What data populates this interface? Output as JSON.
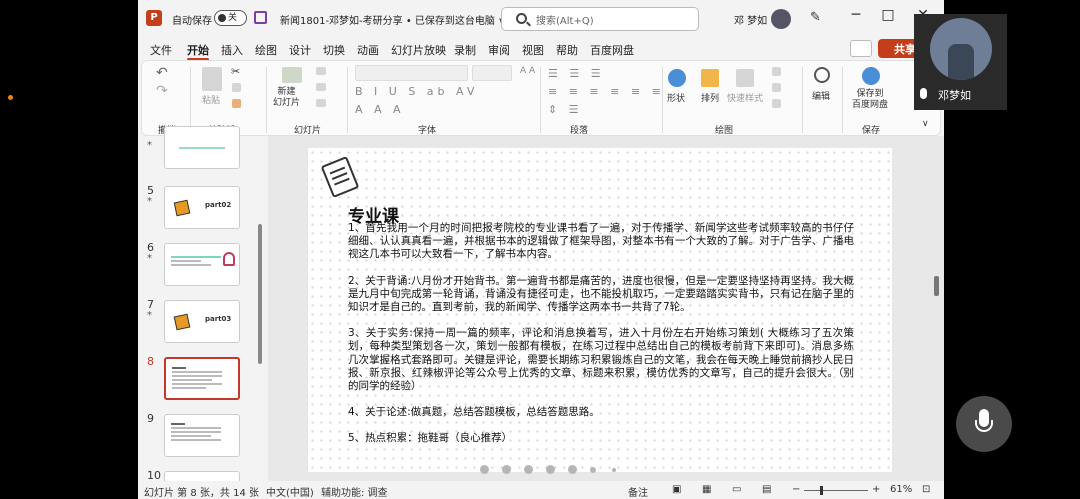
{
  "titlebar": {
    "autosave_label": "自动保存",
    "toggle_state": "关",
    "doc_title": "新闻1801-邓梦如-考研分享 • 已保存到这台电脑 ∨",
    "search_placeholder": "搜索(Alt+Q)",
    "user_name": "邓 梦如",
    "minimize": "─",
    "restore": "□",
    "close": "✕"
  },
  "tabs": [
    "文件",
    "开始",
    "插入",
    "绘图",
    "设计",
    "切换",
    "动画",
    "幻灯片放映",
    "录制",
    "审阅",
    "视图",
    "帮助",
    "百度网盘"
  ],
  "active_tab": "开始",
  "share_label": "共享",
  "ribbon": {
    "undo_group": "撤消",
    "clipboard_group": "剪贴板",
    "paste_label": "粘贴",
    "slides_group": "幻灯片",
    "new_slide_label": "新建\n幻灯片",
    "font_group": "字体",
    "paragraph_group": "段落",
    "drawing_group": "绘图",
    "shape_label": "形状",
    "arrange_label": "排列",
    "quickstyle_label": "快速样式",
    "edit_label": "编辑",
    "save_label": "保存到\n百度网盘",
    "save_group": "保存",
    "font_glyphs": "B I U S ab AV",
    "para_glyphs": "≡ ≡ ≡ ≡ ≡ ≡"
  },
  "thumbnails": [
    {
      "num": "5",
      "label": "part02\n"
    },
    {
      "num": "6",
      "label": ""
    },
    {
      "num": "7",
      "label": "part03\n"
    },
    {
      "num": "8",
      "label": ""
    },
    {
      "num": "9",
      "label": ""
    },
    {
      "num": "10",
      "label": ""
    }
  ],
  "slide": {
    "title": "专业课",
    "paragraphs": [
      "1、首先我用一个月的时间把报考院校的专业课书看了一遍，对于传播学、新闻学这些考试频率较高的书仔仔细细、认认真真看一遍，并根据书本的逻辑做了框架导图，对整本书有一个大致的了解。对于广告学、广播电视这几本书可以大致看一下，了解书本内容。",
      "2、关于背诵:八月份才开始背书。第一遍背书都是痛苦的，进度也很慢，但是一定要坚持坚持再坚持。我大概是九月中旬完成第一轮背诵，背诵没有捷径可走，也不能投机取巧，一定要踏踏实实背书，只有记在脑子里的知识才是自己的。直到考前，我的新闻学、传播学这两本书一共背了7轮。",
      "3、关于实务:保持一周一篇的频率，评论和消息换着写，进入十月份左右开始练习策划( 大概练习了五次策划，每种类型策划各一次，策划一般都有模板，在练习过程中总结出自己的模板考前背下来即可)。消息多练几次掌握格式套路即可。关键是评论，需要长期练习积累锻炼自己的文笔，我会在每天晚上睡觉前摘抄人民日报、新京报、红辣椒评论等公众号上优秀的文章、标题来积累，模仿优秀的文章写，自己的提升会很大。（别的同学的经验）",
      "4、关于论述:做真题，总结答题模板，总结答题思路。",
      "5、热点积累：拖鞋哥（良心推荐）"
    ]
  },
  "status": {
    "slide_info": "幻灯片 第 8 张，共 14 张",
    "language": "中文(中国)",
    "accessibility": "辅助功能: 调查",
    "notes": "备注",
    "zoom": "61%"
  },
  "camera": {
    "name": "邓梦如"
  }
}
